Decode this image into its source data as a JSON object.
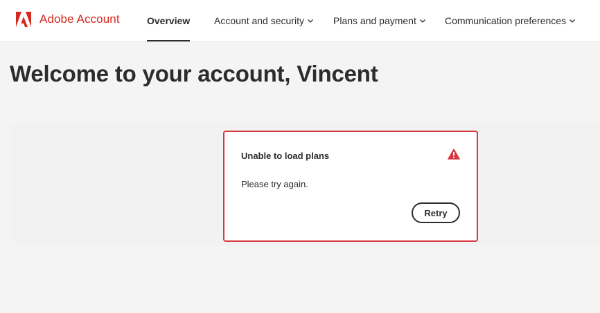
{
  "header": {
    "brand": {
      "logo_icon": "adobe-logo-icon",
      "name": "Adobe Account",
      "color": "#d7281f"
    },
    "nav": {
      "overview": "Overview",
      "security": "Account and security",
      "plans": "Plans and payment",
      "communications": "Communication preferences",
      "active": "Overview",
      "dropdown_icon": "chevron-down-icon"
    }
  },
  "main": {
    "title": "Welcome to your account, Vincent",
    "plans_error": {
      "title": "Unable to load plans",
      "message": "Please try again.",
      "retry_label": "Retry",
      "icon": "alert-icon",
      "border_color": "#d7373f"
    }
  }
}
